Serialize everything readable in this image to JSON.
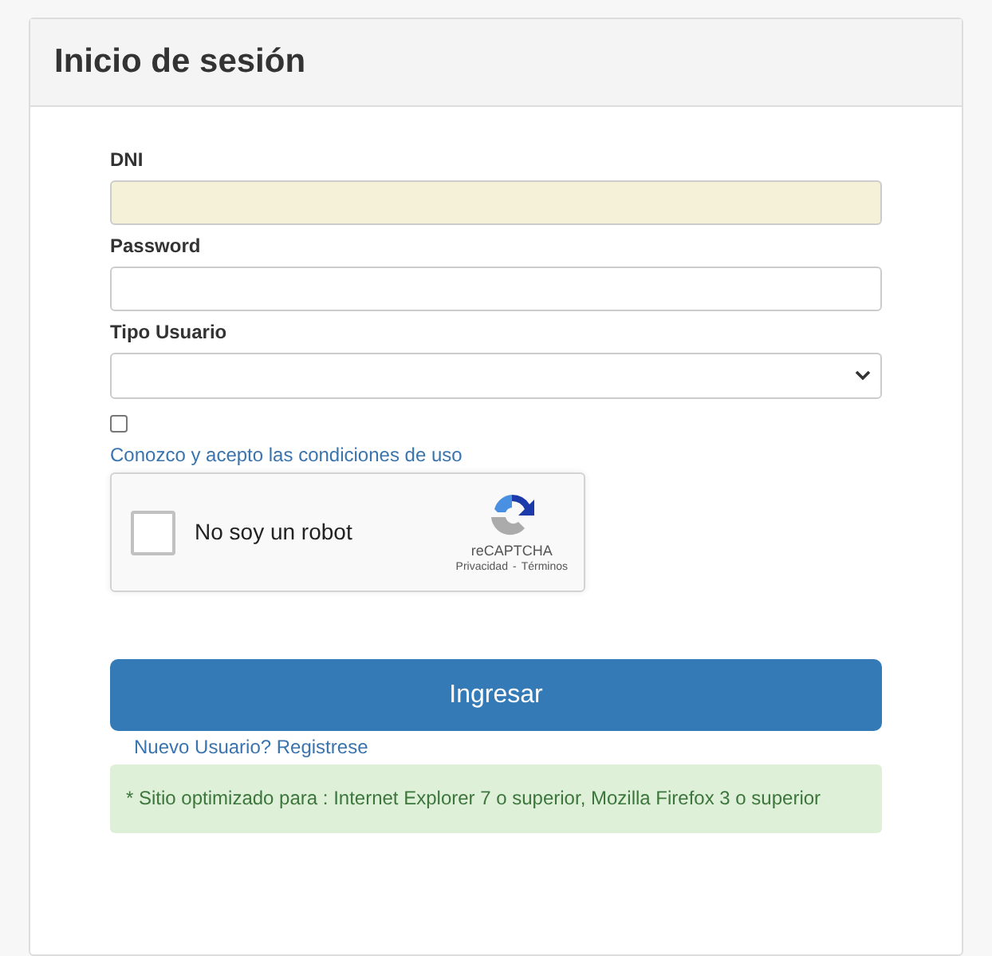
{
  "panel": {
    "title": "Inicio de sesión"
  },
  "fields": [
    {
      "kind": "text",
      "label": "DNI",
      "autofilled": true
    },
    {
      "kind": "password",
      "label": "Password",
      "autofilled": false
    },
    {
      "kind": "select",
      "label": "Tipo Usuario",
      "autofilled": false
    }
  ],
  "terms": {
    "checked": false,
    "link": "Conozco y acepto las condiciones de uso"
  },
  "captcha": {
    "checked": false,
    "label": "No soy un robot",
    "brand": "reCAPTCHA",
    "privacy": "Privacidad",
    "separator": "-",
    "terms": "Términos"
  },
  "submit": "Ingresar",
  "register_link": "Nuevo Usuario? Registrese",
  "notice": "* Sitio optimizado para : Internet Explorer 7 o superior, Mozilla Firefox 3 o superior"
}
